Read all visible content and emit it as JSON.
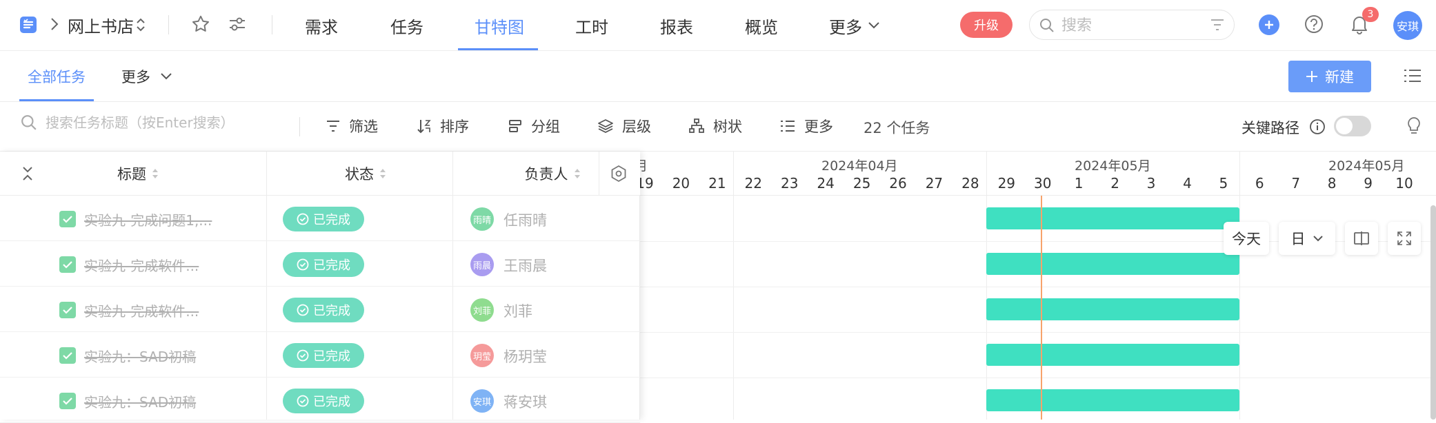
{
  "header": {
    "project_name": "网上书店",
    "nav_tabs": [
      {
        "label": "需求",
        "active": false
      },
      {
        "label": "任务",
        "active": false
      },
      {
        "label": "甘特图",
        "active": true
      },
      {
        "label": "工时",
        "active": false
      },
      {
        "label": "报表",
        "active": false
      },
      {
        "label": "概览",
        "active": false
      },
      {
        "label": "更多",
        "active": false
      }
    ],
    "upgrade_label": "升级",
    "search_placeholder": "搜索",
    "notification_count": "3",
    "user_avatar_text": "安琪"
  },
  "subbar": {
    "tabs": [
      {
        "label": "全部任务",
        "active": true
      },
      {
        "label": "更多",
        "active": false
      }
    ],
    "new_button_label": "新建"
  },
  "toolbar": {
    "search_placeholder": "搜索任务标题（按Enter搜索）",
    "items": [
      "筛选",
      "排序",
      "分组",
      "层级",
      "树状",
      "更多"
    ],
    "task_count": "22 个任务",
    "critical_path_label": "关键路径"
  },
  "table": {
    "columns": [
      "标题",
      "状态",
      "负责人"
    ],
    "rows": [
      {
        "title": "实验九-完成问题1,...",
        "status": "已完成",
        "avatar_text": "雨晴",
        "avatar_color": "#7ed9a6",
        "assignee": "任雨晴"
      },
      {
        "title": "实验九-完成软件...",
        "status": "已完成",
        "avatar_text": "雨晨",
        "avatar_color": "#a99cf0",
        "assignee": "王雨晨"
      },
      {
        "title": "实验九-完成软件...",
        "status": "已完成",
        "avatar_text": "刘菲",
        "avatar_color": "#8fdc8f",
        "assignee": "刘菲"
      },
      {
        "title": "实验九：SAD初稿",
        "status": "已完成",
        "avatar_text": "玥莹",
        "avatar_color": "#f59a9a",
        "assignee": "杨玥莹"
      },
      {
        "title": "实验九：SAD初稿",
        "status": "已完成",
        "avatar_text": "安琪",
        "avatar_color": "#7fb3f5",
        "assignee": "蒋安琪"
      }
    ]
  },
  "gantt": {
    "months": [
      "2024年04月",
      "2024年05月",
      "2024年05月"
    ],
    "partial_month_glyph": "月",
    "days": [
      "19",
      "20",
      "21",
      "22",
      "23",
      "24",
      "25",
      "26",
      "27",
      "28",
      "29",
      "30",
      "1",
      "2",
      "3",
      "4",
      "5",
      "6",
      "7",
      "8",
      "9",
      "10",
      "1"
    ],
    "today_label": "今天",
    "scale_label": "日"
  },
  "colors": {
    "accent": "#5b8ff9",
    "bar": "#3fe0c1",
    "status_done": "#6fdcc0",
    "today_line": "#f7a36b",
    "upgrade": "#f56c6c"
  }
}
